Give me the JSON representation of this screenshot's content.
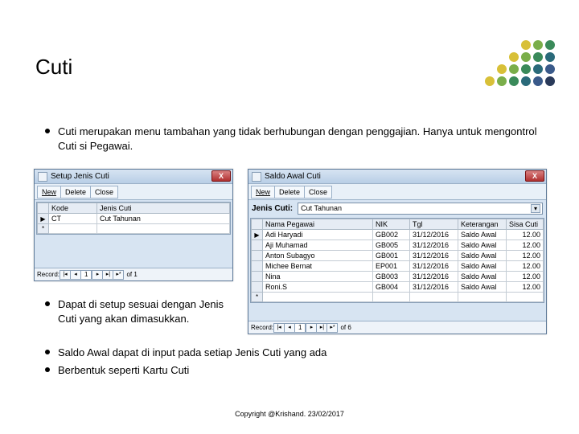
{
  "title": "Cuti",
  "bullets": {
    "b1": "Cuti merupakan menu tambahan yang tidak berhubungan dengan penggajian. Hanya untuk mengontrol Cuti si Pegawai.",
    "b2": "Dapat di setup sesuai dengan Jenis Cuti yang akan dimasukkan.",
    "b3a": "Saldo Awal dapat di input pada setiap Jenis Cuti yang ada",
    "b3b": "Berbentuk seperti Kartu Cuti"
  },
  "win1": {
    "title": "Setup Jenis Cuti",
    "toolbar": {
      "new": "New",
      "delete": "Delete",
      "close": "Close"
    },
    "cols": {
      "kode": "Kode",
      "jenis": "Jenis Cuti"
    },
    "rows": [
      {
        "marker": "▶",
        "kode": "CT",
        "jenis": "Cut Tahunan"
      },
      {
        "marker": "*",
        "kode": "",
        "jenis": ""
      }
    ],
    "nav": {
      "label": "Record:",
      "pos": "1",
      "of": "of 1"
    }
  },
  "win2": {
    "title": "Saldo Awal Cuti",
    "toolbar": {
      "new": "New",
      "delete": "Delete",
      "close": "Close"
    },
    "jenis_label": "Jenis Cuti:",
    "jenis_value": "Cut Tahunan",
    "cols": {
      "nama": "Nama Pegawai",
      "nik": "NIK",
      "tgl": "Tgl",
      "ket": "Keterangan",
      "sisa": "Sisa Cuti"
    },
    "rows": [
      {
        "marker": "▶",
        "nama": "Adi Haryadi",
        "nik": "GB002",
        "tgl": "31/12/2016",
        "ket": "Saldo Awal",
        "sisa": "12.00"
      },
      {
        "marker": "",
        "nama": "Aji Muhamad",
        "nik": "GB005",
        "tgl": "31/12/2016",
        "ket": "Saldo Awal",
        "sisa": "12.00"
      },
      {
        "marker": "",
        "nama": "Anton Subagyo",
        "nik": "GB001",
        "tgl": "31/12/2016",
        "ket": "Saldo Awal",
        "sisa": "12.00"
      },
      {
        "marker": "",
        "nama": "Michee Bernat",
        "nik": "EP001",
        "tgl": "31/12/2016",
        "ket": "Saldo Awal",
        "sisa": "12.00"
      },
      {
        "marker": "",
        "nama": "Nina",
        "nik": "GB003",
        "tgl": "31/12/2016",
        "ket": "Saldo Awal",
        "sisa": "12.00"
      },
      {
        "marker": "",
        "nama": "Roni.S",
        "nik": "GB004",
        "tgl": "31/12/2016",
        "ket": "Saldo Awal",
        "sisa": "12.00"
      },
      {
        "marker": "*",
        "nama": "",
        "nik": "",
        "tgl": "",
        "ket": "",
        "sisa": ""
      }
    ],
    "nav": {
      "label": "Record:",
      "pos": "1",
      "of": "of 6"
    }
  },
  "copyright": "Copyright @Krishand. 23/02/2017",
  "deco_colors": [
    "#d8c038",
    "#7aae4a",
    "#3a8a5a",
    "#2a6a7a",
    "#3a5a8a",
    "#2a3a5a"
  ]
}
